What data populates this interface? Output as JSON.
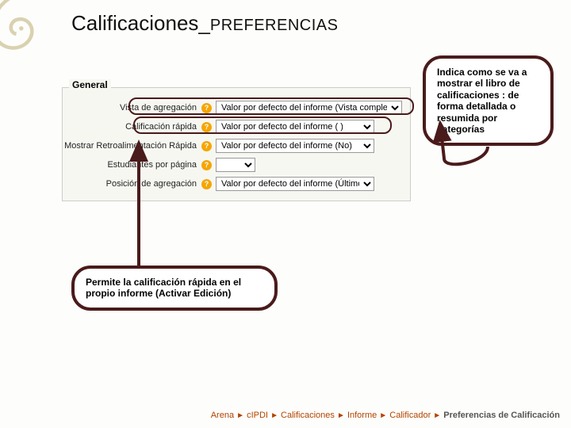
{
  "title": {
    "main": "Calificaciones_",
    "suffix": "PREFERENCIAS"
  },
  "panel": {
    "legend": "General",
    "rows": {
      "r1": {
        "label": "Vista de agregación",
        "value": "Valor por defecto del informe (Vista completa)"
      },
      "r2": {
        "label": "Calificación rápida",
        "value": "Valor por defecto del informe ( )"
      },
      "r3": {
        "label": "Mostrar Retroalimentación Rápida",
        "value": "Valor por defecto del informe (No)"
      },
      "r4": {
        "label": "Estudiantes por página",
        "value": ""
      },
      "r5": {
        "label": "Posición de agregación",
        "value": "Valor por defecto del informe (Último)"
      }
    }
  },
  "callouts": {
    "top": "Indica como se va a mostrar el libro de calificaciones : de forma detallada o resumida por categorías",
    "bottom": "Permite la calificación rápida en el propio informe (Activar Edición)"
  },
  "breadcrumb": {
    "items": [
      "Arena",
      "cIPDI",
      "Calificaciones",
      "Informe",
      "Calificador"
    ],
    "current": "Preferencias de Calificación",
    "sep": "►"
  },
  "icons": {
    "help": "?"
  }
}
